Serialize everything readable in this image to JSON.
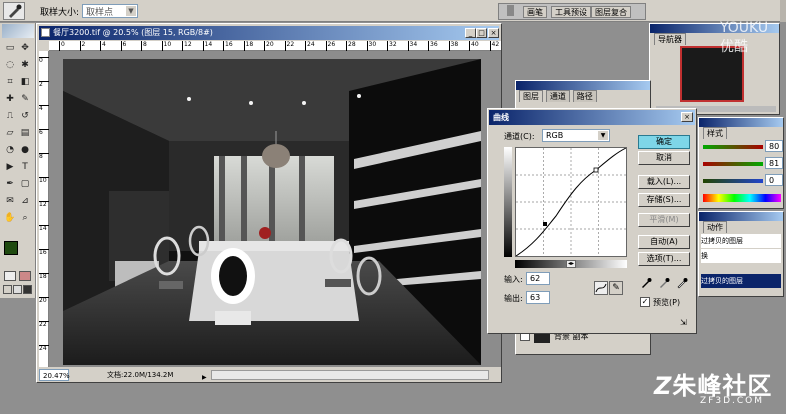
{
  "options_bar": {
    "sample_size_label": "取样大小:",
    "sample_size_value": "取样点"
  },
  "palette_well": {
    "tabs": [
      "画笔",
      "工具预设",
      "图层复合"
    ]
  },
  "document": {
    "title": "餐厅3200.tif @ 20.5% (图层 15, RGB/8#)",
    "zoom_status": "20.47%",
    "doc_size": "文档:22.0M/134.2M",
    "ruler_ticks": [
      "0",
      "2",
      "4",
      "6",
      "8",
      "10",
      "12",
      "14",
      "16",
      "18",
      "20",
      "22",
      "24",
      "26",
      "28",
      "30",
      "32",
      "34",
      "36",
      "38",
      "40",
      "42"
    ],
    "vruler_ticks": [
      "0",
      "2",
      "4",
      "6",
      "8",
      "10",
      "12",
      "14",
      "16",
      "18",
      "20",
      "22",
      "24"
    ]
  },
  "navigator": {
    "tab": "导航器",
    "watermark": "YOUKU 优酷"
  },
  "color_panel": {
    "tab": "样式",
    "values": [
      "80",
      "81",
      "0"
    ]
  },
  "layers_panel": {
    "tabs": [
      "图层",
      "通道",
      "路径"
    ],
    "bottom_label": "背景 副本"
  },
  "history_panel": {
    "tab": "动作",
    "items": [
      "过拷贝的图层",
      "换",
      "过拷贝的图层"
    ]
  },
  "curves_dialog": {
    "title": "曲线",
    "channel_label": "通道(C):",
    "channel_value": "RGB",
    "input_label": "输入:",
    "input_value": "62",
    "output_label": "输出:",
    "output_value": "63",
    "buttons": {
      "ok": "确定",
      "cancel": "取消",
      "load": "载入(L)...",
      "save": "存储(S)...",
      "smooth": "平滑(M)",
      "auto": "自动(A)",
      "options": "选项(T)..."
    },
    "preview_label": "预览(P)",
    "preview_checked": true
  },
  "site_watermark": {
    "brand": "朱峰社区",
    "url": "ZF3D.COM"
  },
  "colors": {
    "title_bar_start": "#0a246a",
    "title_bar_end": "#a6caf0",
    "chrome": "#d4d0c8",
    "workspace": "#8f8f8f",
    "foreground_swatch": "#1f4a10",
    "ok_highlight": "#7ed6e8",
    "history_selected": "#0a246a"
  },
  "icons": {
    "toolbox": [
      "marquee-icon",
      "move-icon",
      "lasso-icon",
      "magic-wand-icon",
      "crop-icon",
      "slice-icon",
      "healing-icon",
      "brush-icon",
      "stamp-icon",
      "history-brush-icon",
      "eraser-icon",
      "gradient-icon",
      "blur-icon",
      "dodge-icon",
      "path-select-icon",
      "type-icon",
      "pen-icon",
      "shape-icon",
      "notes-icon",
      "eyedropper-icon",
      "hand-icon",
      "zoom-icon"
    ]
  }
}
